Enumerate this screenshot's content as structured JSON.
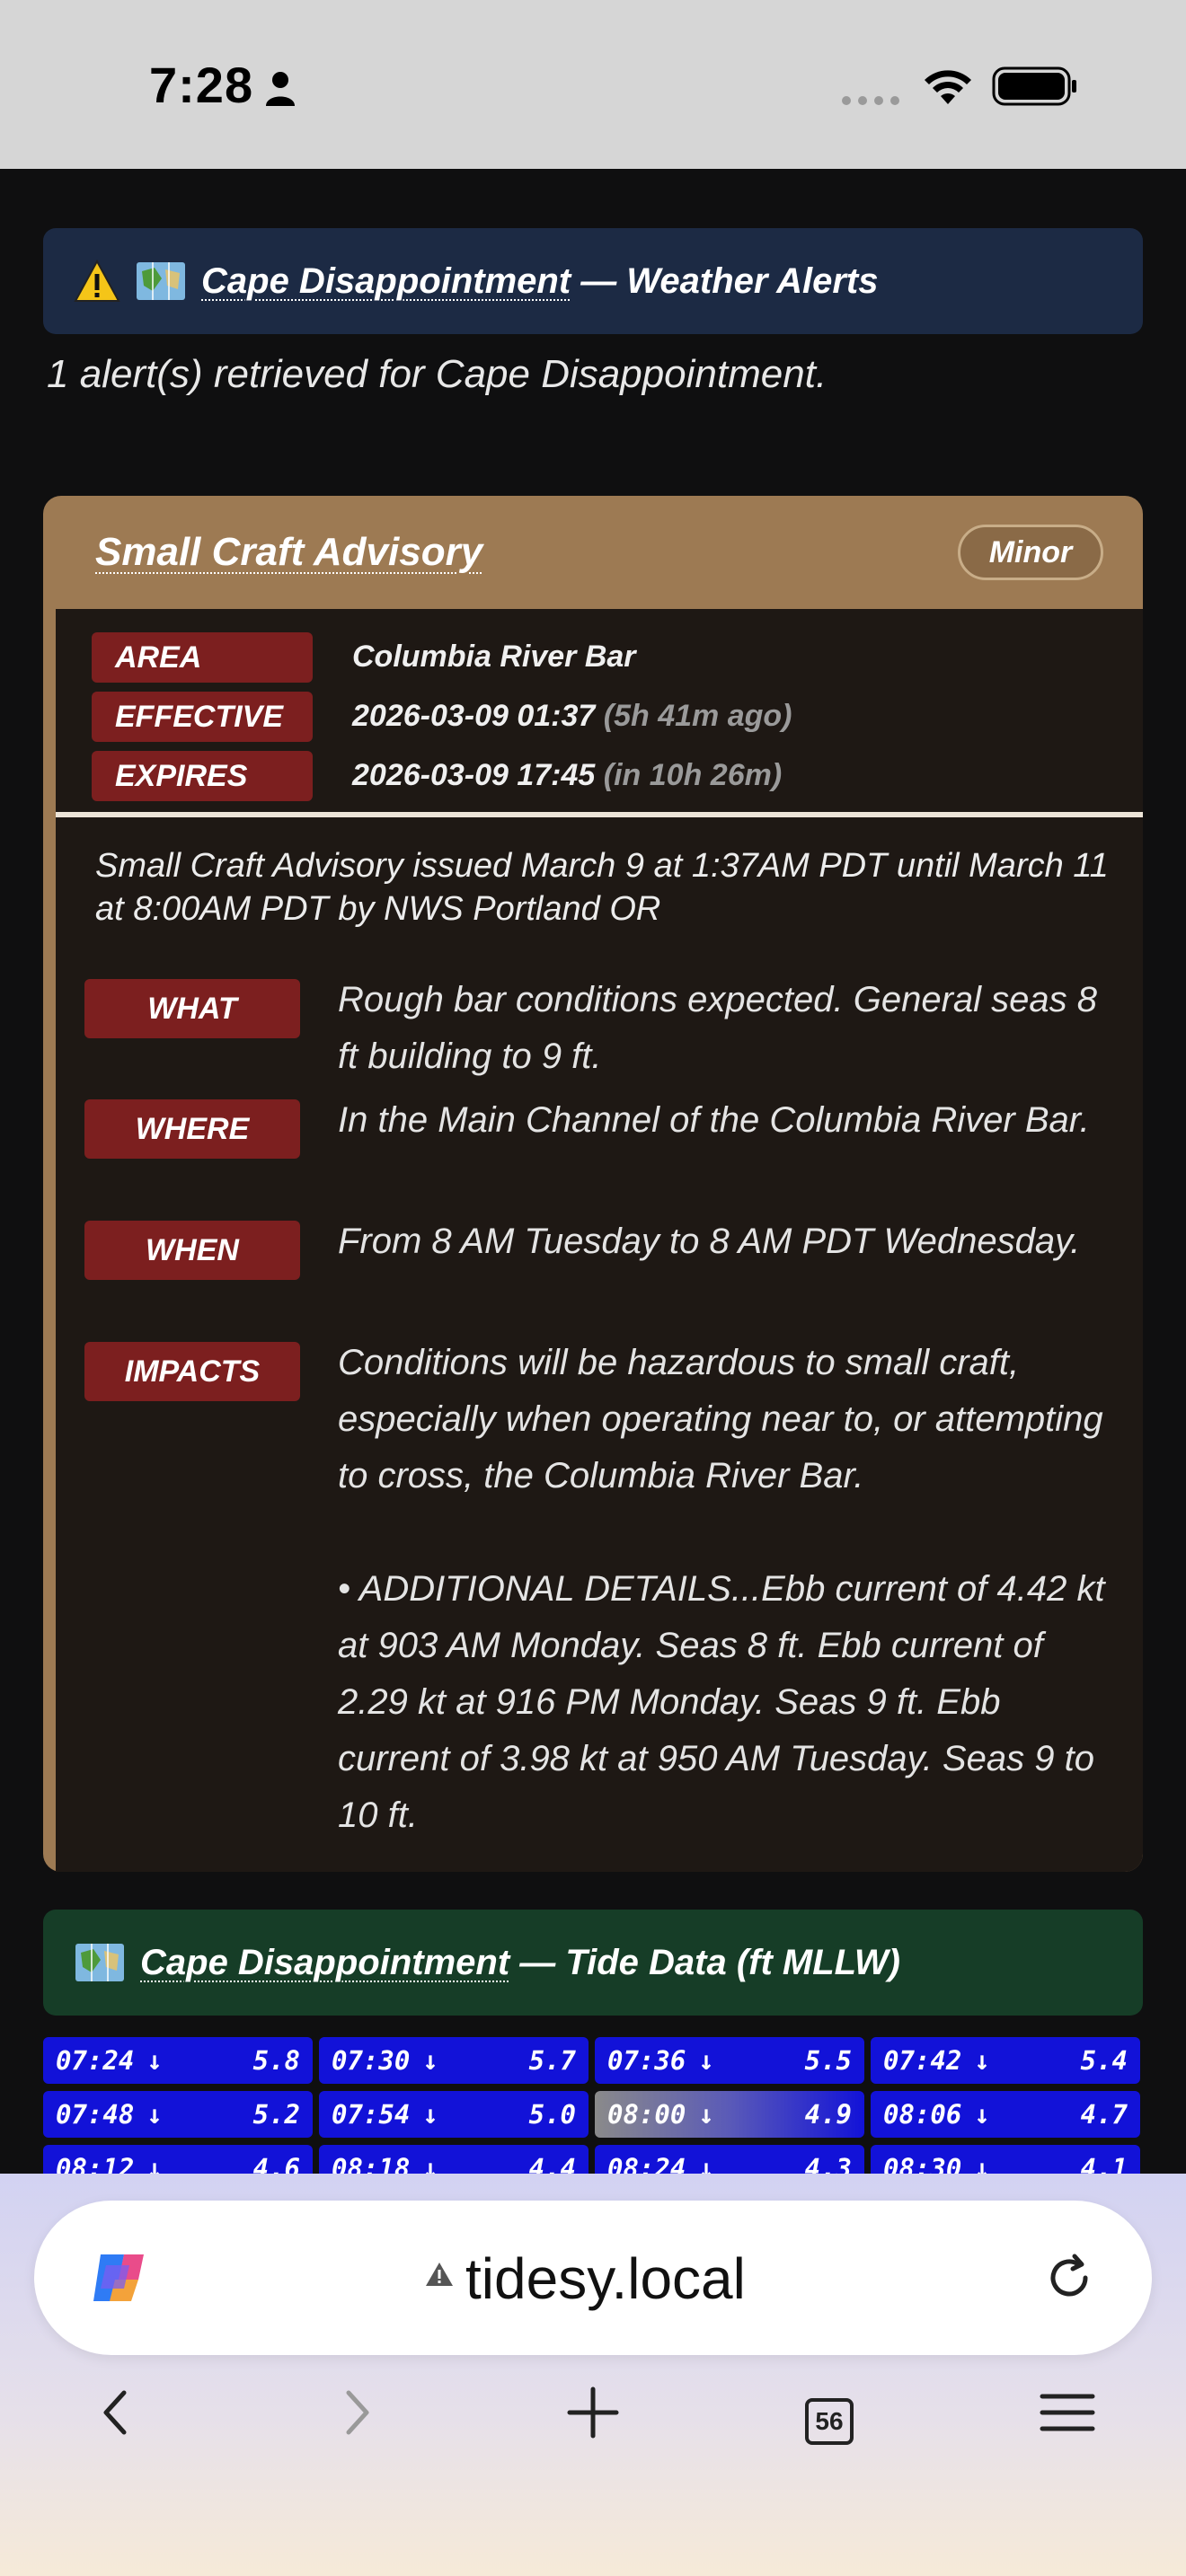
{
  "status_bar": {
    "time": "7:28"
  },
  "alerts_header": {
    "location": "Cape Disappointment",
    "suffix": " — Weather Alerts"
  },
  "alert_count_text": "1 alert(s) retrieved for Cape Disappointment.",
  "alert": {
    "title": "Small Craft Advisory",
    "severity": "Minor",
    "meta": {
      "area_label": "AREA",
      "area_value": "Columbia River Bar",
      "effective_label": "EFFECTIVE",
      "effective_value": "2026-03-09 01:37",
      "effective_rel": "(5h 41m ago)",
      "expires_label": "EXPIRES",
      "expires_value": "2026-03-09 17:45",
      "expires_rel": "(in 10h 26m)"
    },
    "description": "Small Craft Advisory issued March 9 at 1:37AM PDT until March 11 at 8:00AM PDT by NWS Portland OR",
    "sections": {
      "what_label": "WHAT",
      "what_text": "Rough bar conditions expected. General seas 8 ft building to 9 ft.",
      "where_label": "WHERE",
      "where_text": "In the Main Channel of the Columbia River Bar.",
      "when_label": "WHEN",
      "when_text": "From 8 AM Tuesday to 8 AM PDT Wednesday.",
      "impacts_label": "IMPACTS",
      "impacts_text": "Conditions will be hazardous to small craft, especially when operating near to, or attempting to cross, the Columbia River Bar.",
      "additional_text": "• ADDITIONAL DETAILS...Ebb current of 4.42 kt at 903 AM Monday. Seas 8 ft. Ebb current of 2.29 kt at 916 PM Monday. Seas 9 ft. Ebb current of 3.98 kt at 950 AM Tuesday. Seas 9 to 10 ft."
    }
  },
  "tide_header": {
    "location": "Cape Disappointment",
    "suffix": " — Tide Data (ft MLLW)"
  },
  "tides": [
    {
      "time": "07:24",
      "dir": "↓",
      "height": "5.8"
    },
    {
      "time": "07:30",
      "dir": "↓",
      "height": "5.7"
    },
    {
      "time": "07:36",
      "dir": "↓",
      "height": "5.5"
    },
    {
      "time": "07:42",
      "dir": "↓",
      "height": "5.4"
    },
    {
      "time": "07:48",
      "dir": "↓",
      "height": "5.2"
    },
    {
      "time": "07:54",
      "dir": "↓",
      "height": "5.0"
    },
    {
      "time": "08:00",
      "dir": "↓",
      "height": "4.9",
      "current": true
    },
    {
      "time": "08:06",
      "dir": "↓",
      "height": "4.7"
    },
    {
      "time": "08:12",
      "dir": "↓",
      "height": "4.6"
    },
    {
      "time": "08:18",
      "dir": "↓",
      "height": "4.4"
    },
    {
      "time": "08:24",
      "dir": "↓",
      "height": "4.3"
    },
    {
      "time": "08:30",
      "dir": "↓",
      "height": "4.1"
    }
  ],
  "browser": {
    "url": "tidesy.local",
    "tab_count": "56"
  },
  "colors": {
    "alerts_header_bg": "#1c2a44",
    "tide_header_bg": "#163d27",
    "card_accent": "#9d7a53",
    "label_bg": "#7c1f1f",
    "tide_cell_bg": "#1212d8"
  }
}
